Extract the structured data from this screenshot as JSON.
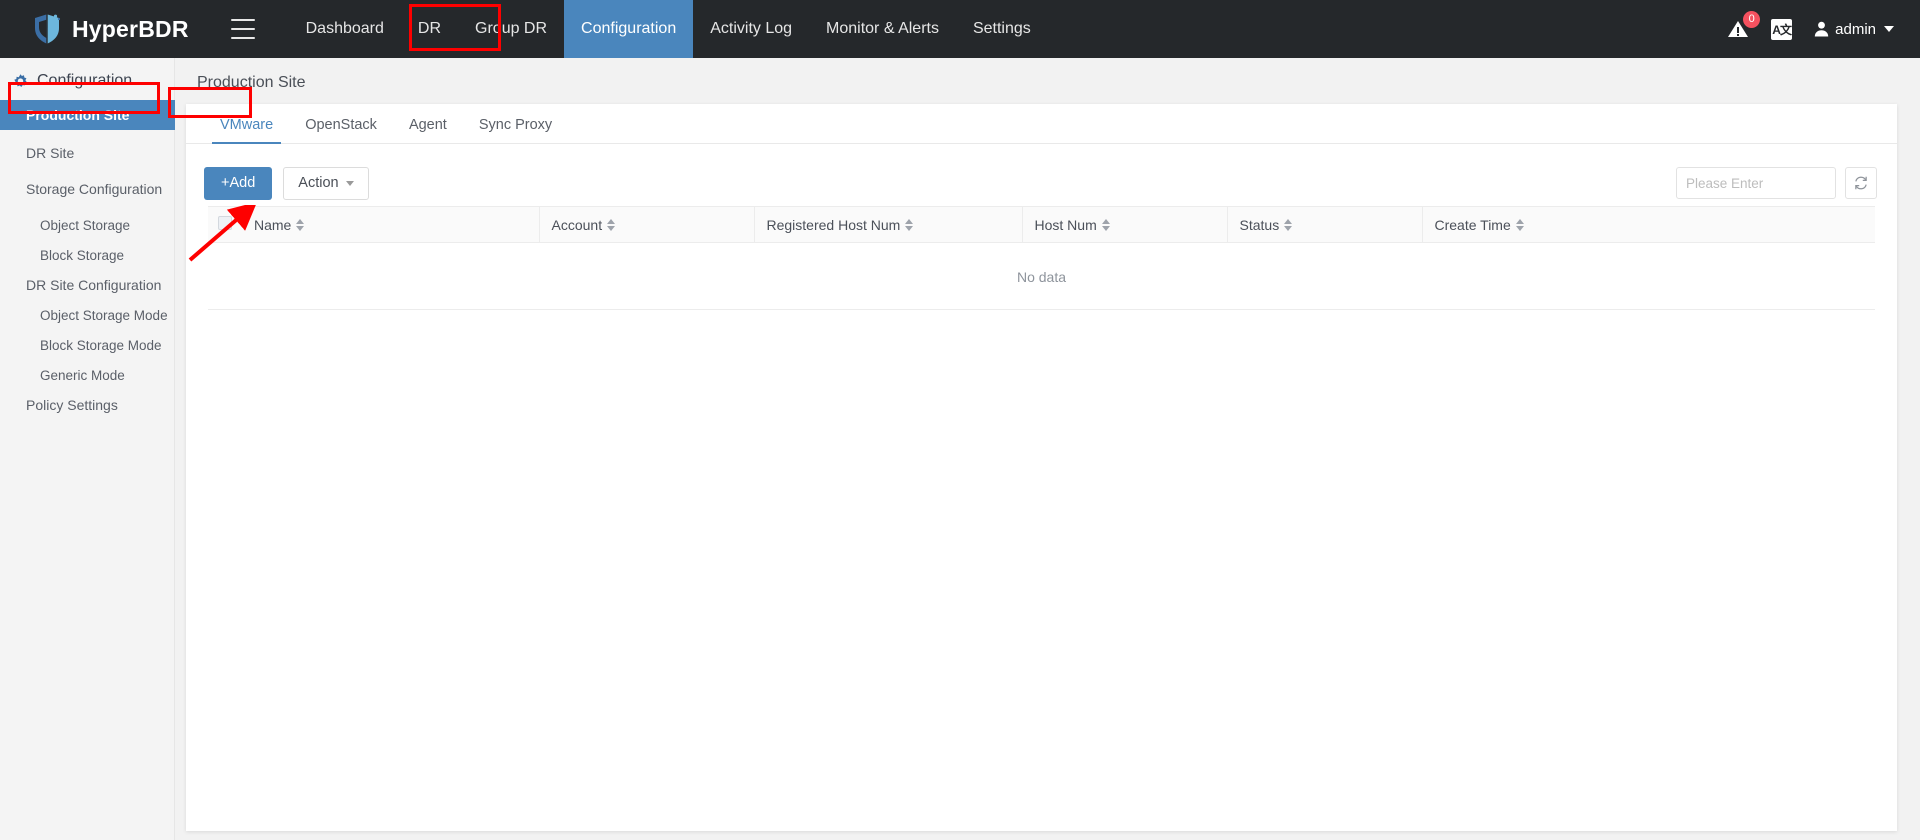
{
  "app": {
    "brand": "HyperBDR",
    "logo_icon": "shield-icon",
    "menu_icon": "hamburger-icon"
  },
  "topnav": {
    "items": [
      {
        "label": "Dashboard",
        "active": false
      },
      {
        "label": "DR",
        "active": false
      },
      {
        "label": "Group DR",
        "active": false
      },
      {
        "label": "Configuration",
        "active": true
      },
      {
        "label": "Activity Log",
        "active": false
      },
      {
        "label": "Monitor & Alerts",
        "active": false
      },
      {
        "label": "Settings",
        "active": false
      }
    ],
    "alert_icon": "warning-triangle-icon",
    "alert_badge": "0",
    "lang_icon": "language-switch-icon",
    "lang_label": "A文",
    "user_icon": "user-icon",
    "user_label": "admin",
    "user_caret_icon": "chevron-down-icon"
  },
  "sidebar": {
    "title": "Configuration",
    "title_icon": "gear-icon",
    "items": [
      {
        "label": "Production Site",
        "level": 1,
        "selected": true
      },
      {
        "label": "DR Site",
        "level": 1,
        "selected": false
      },
      {
        "label": "Storage Configuration",
        "level": 1,
        "selected": false
      },
      {
        "label": "Object Storage",
        "level": 2,
        "selected": false
      },
      {
        "label": "Block Storage",
        "level": 2,
        "selected": false
      },
      {
        "label": "DR Site Configuration",
        "level": 1,
        "selected": false
      },
      {
        "label": "Object Storage Mode",
        "level": 2,
        "selected": false
      },
      {
        "label": "Block Storage Mode",
        "level": 2,
        "selected": false
      },
      {
        "label": "Generic Mode",
        "level": 2,
        "selected": false
      },
      {
        "label": "Policy Settings",
        "level": 1,
        "selected": false
      }
    ]
  },
  "page": {
    "title": "Production Site"
  },
  "tabs": [
    {
      "label": "VMware",
      "active": true
    },
    {
      "label": "OpenStack",
      "active": false
    },
    {
      "label": "Agent",
      "active": false
    },
    {
      "label": "Sync Proxy",
      "active": false
    }
  ],
  "toolbar": {
    "add_label": "+Add",
    "action_label": "Action",
    "action_caret_icon": "chevron-down-icon",
    "search_placeholder": "Please Enter",
    "search_value": "",
    "search_icon": "search-icon",
    "refresh_icon": "refresh-icon"
  },
  "table": {
    "select_all_checkbox": "unchecked",
    "columns": [
      {
        "label": "Name",
        "sortable": true
      },
      {
        "label": "Account",
        "sortable": true
      },
      {
        "label": "Registered Host Num",
        "sortable": true
      },
      {
        "label": "Host Num",
        "sortable": true
      },
      {
        "label": "Status",
        "sortable": true
      },
      {
        "label": "Create Time",
        "sortable": true
      }
    ],
    "rows": [],
    "empty_text": "No data"
  },
  "annotations": {
    "accent_color": "#fe0000",
    "boxes": [
      {
        "name": "configuration-nav-highlight"
      },
      {
        "name": "production-site-sidebar-highlight"
      },
      {
        "name": "vmware-tab-highlight"
      }
    ],
    "arrow": {
      "name": "add-button-arrow",
      "points_to": "+Add"
    }
  },
  "colors": {
    "nav_bg": "#25282b",
    "accent_blue": "#4a86bd",
    "page_bg": "#f2f2f2",
    "sidebar_bg": "#f4f4f4",
    "badge_red": "#f5515f"
  }
}
